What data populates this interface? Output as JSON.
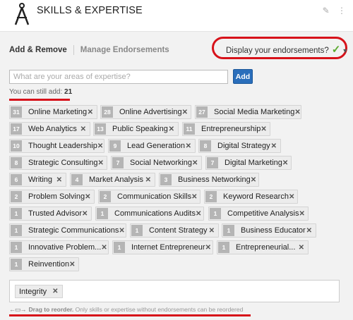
{
  "header": {
    "title": "SKILLS & EXPERTISE"
  },
  "tabs": {
    "active": "Add & Remove",
    "other": "Manage Endorsements"
  },
  "display_endorsements": {
    "label": "Display your endorsements?"
  },
  "add_form": {
    "placeholder": "What are your areas of expertise?",
    "button": "Add",
    "still_label": "You can still add:",
    "still_count": "21"
  },
  "skills": [
    {
      "count": "31",
      "name": "Online Marketing"
    },
    {
      "count": "28",
      "name": "Online Advertising"
    },
    {
      "count": "27",
      "name": "Social Media Marketing"
    },
    {
      "count": "17",
      "name": "Web Analytics"
    },
    {
      "count": "13",
      "name": "Public Speaking"
    },
    {
      "count": "11",
      "name": "Entrepreneurship"
    },
    {
      "count": "10",
      "name": "Thought Leadership"
    },
    {
      "count": "9",
      "name": "Lead Generation"
    },
    {
      "count": "8",
      "name": "Digital Strategy"
    },
    {
      "count": "8",
      "name": "Strategic Consulting"
    },
    {
      "count": "7",
      "name": "Social Networking"
    },
    {
      "count": "7",
      "name": "Digital Marketing"
    },
    {
      "count": "6",
      "name": "Writing"
    },
    {
      "count": "4",
      "name": "Market Analysis"
    },
    {
      "count": "3",
      "name": "Business Networking"
    },
    {
      "count": "2",
      "name": "Problem Solving"
    },
    {
      "count": "2",
      "name": "Communication Skills"
    },
    {
      "count": "2",
      "name": "Keyword Research"
    },
    {
      "count": "1",
      "name": "Trusted Advisor"
    },
    {
      "count": "1",
      "name": "Communications Audits"
    },
    {
      "count": "1",
      "name": "Competitive Analysis"
    },
    {
      "count": "1",
      "name": "Strategic Communications"
    },
    {
      "count": "1",
      "name": "Content Strategy"
    },
    {
      "count": "1",
      "name": "Business Educator"
    },
    {
      "count": "1",
      "name": "Innovative Problem..."
    },
    {
      "count": "1",
      "name": "Internet Entrepreneur"
    },
    {
      "count": "1",
      "name": "Entrepreneurial..."
    },
    {
      "count": "1",
      "name": "Reinvention"
    }
  ],
  "unendorsed": [
    {
      "name": "Integrity"
    }
  ],
  "hint": {
    "bold": "Drag to reorder.",
    "rest": "Only skills or expertise without endorsements can be reordered"
  },
  "icons": {
    "logo": "compass-icon",
    "edit": "pencil-icon",
    "move": "move-handle-icon",
    "check": "checkmark-icon",
    "drag": "drag-arrows-icon"
  },
  "colors": {
    "accent": "#2a6ebb",
    "annotation": "#d7121a",
    "check": "#5aaa2f"
  }
}
